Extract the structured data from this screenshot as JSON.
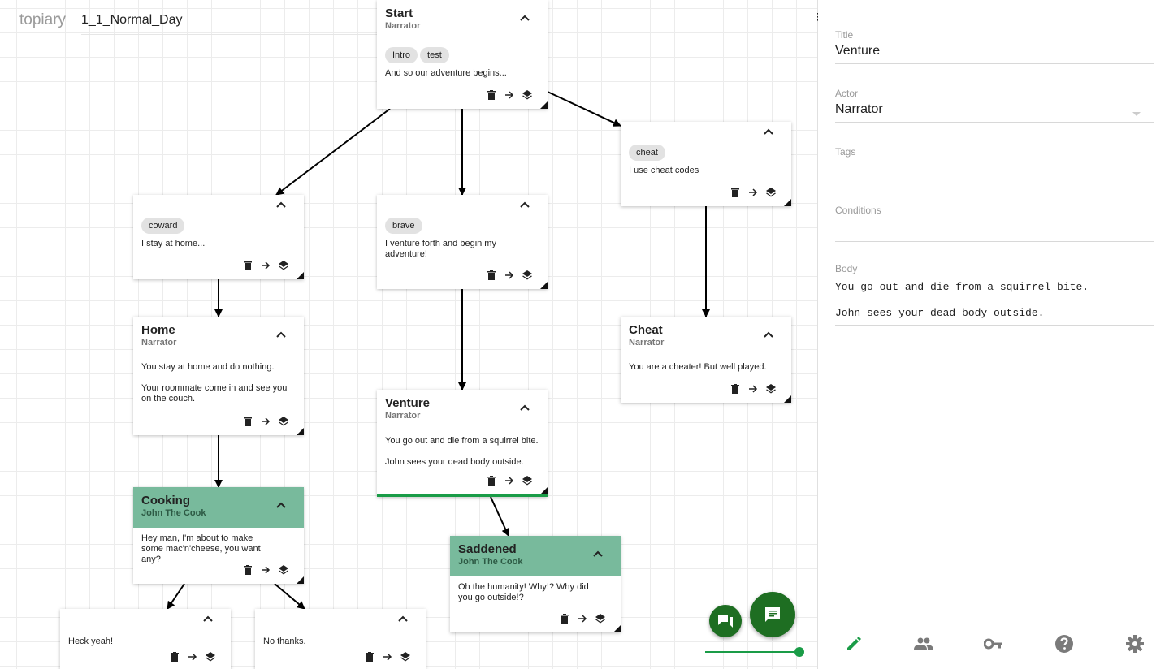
{
  "app": {
    "brand": "topiary",
    "document_name": "1_1_Normal_Day"
  },
  "nodes": {
    "start": {
      "title": "Start",
      "actor": "Narrator",
      "tags": [
        "Intro",
        "test"
      ],
      "body": [
        "And so our adventure begins..."
      ]
    },
    "cheat_choice": {
      "tags": [
        "cheat"
      ],
      "body": [
        "I use cheat codes"
      ]
    },
    "coward_choice": {
      "tags": [
        "coward"
      ],
      "body": [
        "I stay at home..."
      ]
    },
    "brave_choice": {
      "tags": [
        "brave"
      ],
      "body": [
        "I venture forth and begin my adventure!"
      ]
    },
    "home": {
      "title": "Home",
      "actor": "Narrator",
      "body": [
        "You stay at home and do nothing.",
        "Your roommate come in and see you on the couch."
      ]
    },
    "cheat": {
      "title": "Cheat",
      "actor": "Narrator",
      "body": [
        "You are a cheater! But well played."
      ]
    },
    "venture": {
      "title": "Venture",
      "actor": "Narrator",
      "body": [
        "You go out and die from a squirrel bite.",
        "John sees your dead body outside."
      ]
    },
    "cooking": {
      "title": "Cooking",
      "actor": "John The Cook",
      "body": [
        "Hey man, I'm about to make some mac'n'cheese, you want any?"
      ]
    },
    "saddened": {
      "title": "Saddened",
      "actor": "John The Cook",
      "body": [
        "Oh the humanity! Why!? Why did you go outside!?"
      ]
    },
    "heck_yeah": {
      "body": [
        "Heck yeah!"
      ]
    },
    "no_thanks": {
      "body": [
        "No thanks."
      ]
    }
  },
  "panel": {
    "title_label": "Title",
    "title_value": "Venture",
    "actor_label": "Actor",
    "actor_value": "Narrator",
    "tags_label": "Tags",
    "tags_value": "",
    "conditions_label": "Conditions",
    "conditions_value": "",
    "body_label": "Body",
    "body_value": "You go out and die from a squirrel bite.\n\nJohn sees your dead body outside."
  },
  "icons": {
    "bottom_nav": [
      "edit-icon",
      "people-icon",
      "key-icon",
      "help-icon",
      "settings-icon"
    ],
    "node_tools": [
      "delete-icon",
      "arrow-right-icon",
      "layers-icon"
    ]
  },
  "colors": {
    "accent": "#1a9c47",
    "green_header": "#78ba9c",
    "fab": "#1e6e22",
    "active_tab": "#1a9c47",
    "inactive_tab": "#7a7a7a"
  }
}
